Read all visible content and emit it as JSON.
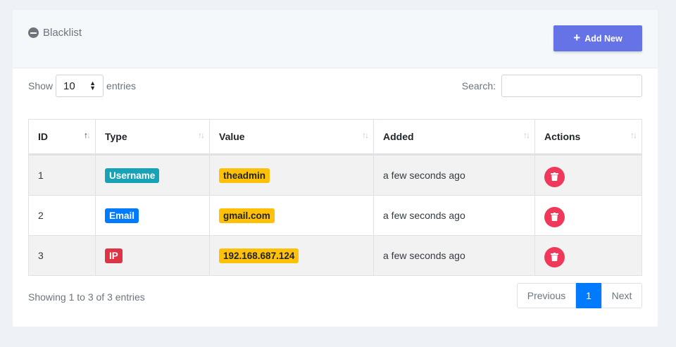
{
  "card": {
    "title": "Blacklist",
    "add_button_label": "Add New",
    "accent_color": "#6673e6"
  },
  "controls": {
    "show_label": "Show",
    "entries_value": "10",
    "entries_label": "entries",
    "search_label": "Search:",
    "search_value": ""
  },
  "table": {
    "columns": [
      "ID",
      "Type",
      "Value",
      "Added",
      "Actions"
    ],
    "rows": [
      {
        "id": "1",
        "type": "Username",
        "type_color": "#17a2b8",
        "value": "theadmin",
        "added": "a few seconds ago"
      },
      {
        "id": "2",
        "type": "Email",
        "type_color": "#007bff",
        "value": "gmail.com",
        "added": "a few seconds ago"
      },
      {
        "id": "3",
        "type": "IP",
        "type_color": "#dc3545",
        "value": "192.168.687.124",
        "added": "a few seconds ago"
      }
    ]
  },
  "footer": {
    "info": "Showing 1 to 3 of 3 entries",
    "previous_label": "Previous",
    "current_page": "1",
    "next_label": "Next"
  }
}
